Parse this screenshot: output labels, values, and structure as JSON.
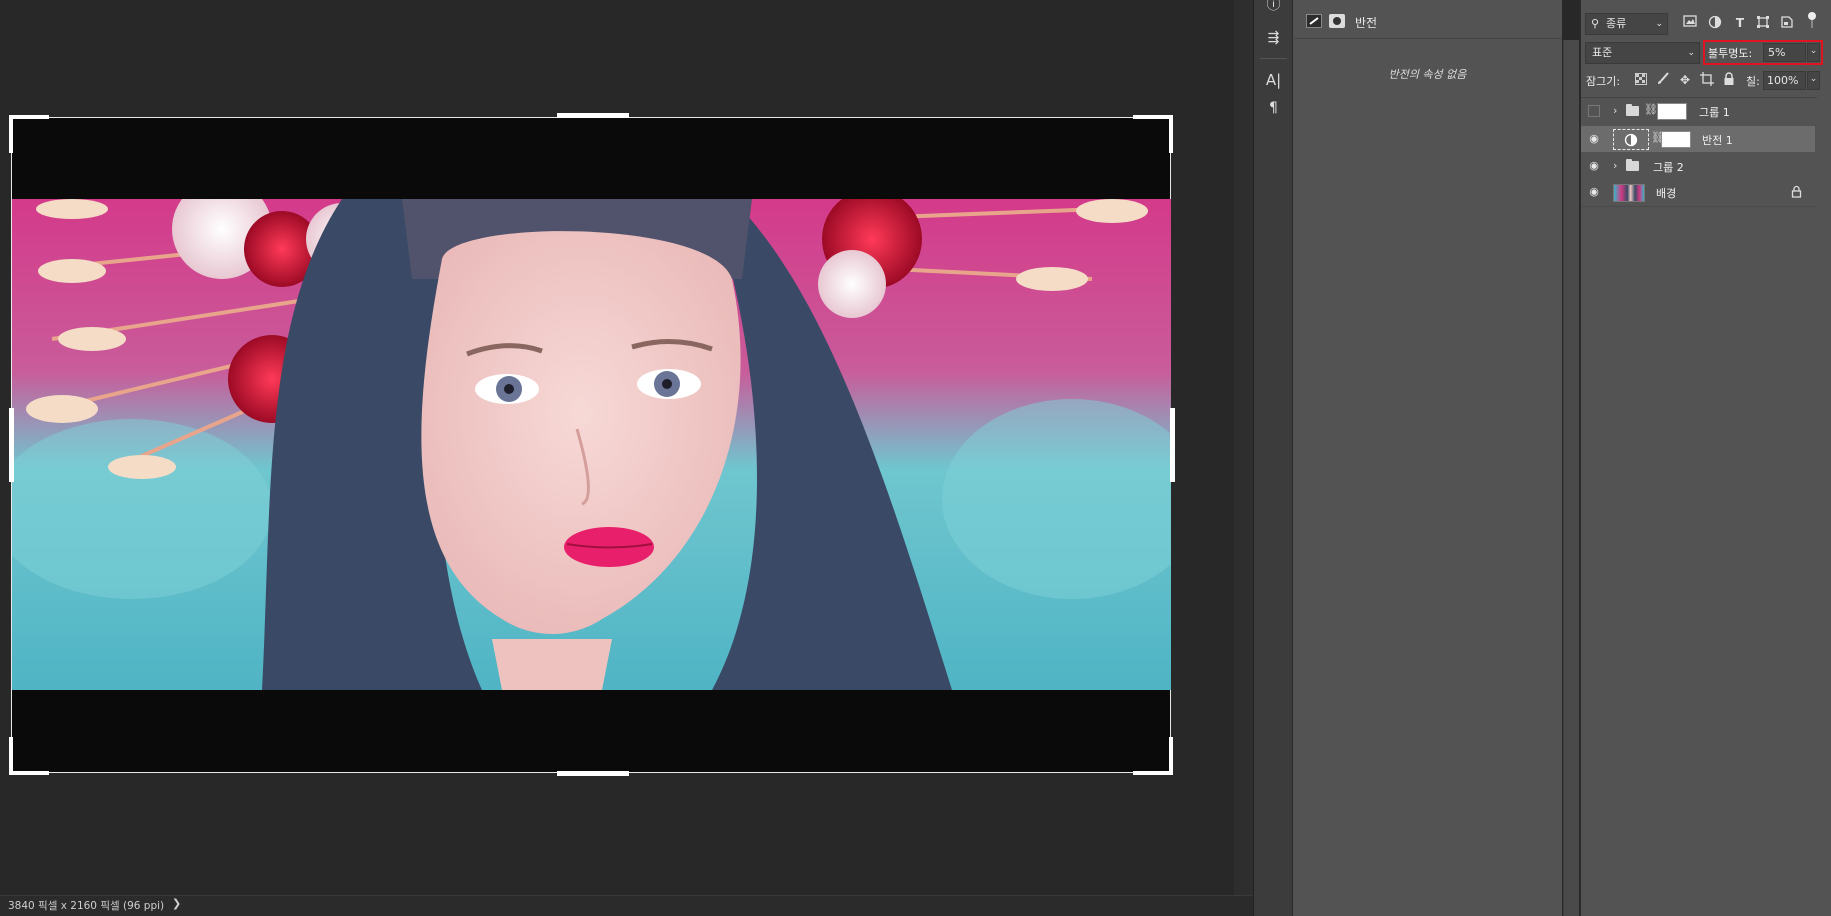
{
  "status_bar": {
    "document_info": "3840 픽셀 x 2160 픽셀 (96 ppi)",
    "expand_chevron": "❯"
  },
  "tools": [
    "info-icon",
    "clone-source-icon",
    "character-icon",
    "paragraph-icon"
  ],
  "tool_glyphs": {
    "info": "ⓘ",
    "clone": "⇶",
    "character": "A|",
    "paragraph": "¶"
  },
  "properties": {
    "title": "반전",
    "empty_message": "반전의 속성 없음"
  },
  "layers_panel": {
    "filter_kind": "종류",
    "blend_mode": "표준",
    "opacity_label": "불투명도:",
    "opacity_value": "5%",
    "lock_label": "잠그기:",
    "fill_label": "칠:",
    "fill_value": "100%",
    "layers": [
      {
        "name": "그룹 1",
        "type": "group",
        "visible": false,
        "selected": false
      },
      {
        "name": "반전 1",
        "type": "adjustment",
        "visible": true,
        "selected": true
      },
      {
        "name": "그룹 2",
        "type": "group",
        "visible": true,
        "selected": false
      },
      {
        "name": "배경",
        "type": "image",
        "visible": true,
        "selected": false,
        "locked": true
      }
    ]
  },
  "colors": {
    "highlight_box": "#e0141e",
    "selected_row": "#6c6c6c",
    "panel_bg": "#535353",
    "canvas_bg": "#282828"
  }
}
